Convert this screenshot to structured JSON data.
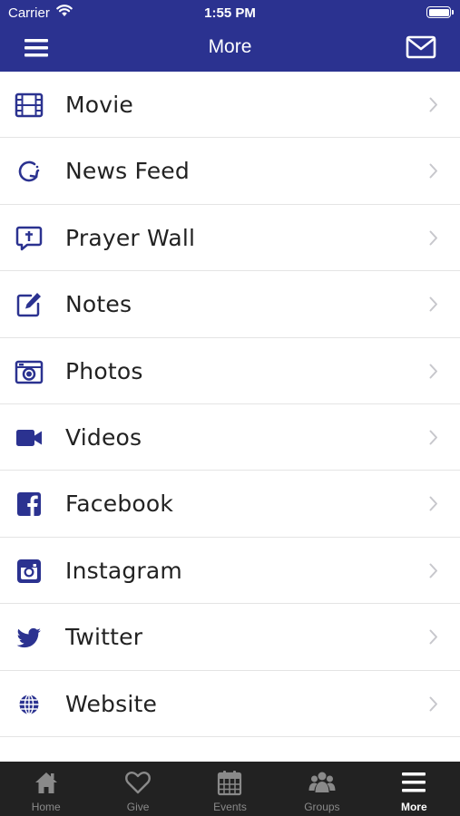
{
  "status_bar": {
    "carrier": "Carrier",
    "time": "1:55 PM"
  },
  "header": {
    "title": "More",
    "menu_icon": "hamburger-menu-icon",
    "mail_icon": "envelope-icon"
  },
  "colors": {
    "brand": "#2b3290",
    "tabbar_bg": "#222222",
    "tab_inactive": "#8a8a8a",
    "tab_active": "#ffffff",
    "chevron": "#c7c7cc"
  },
  "menu": {
    "items": [
      {
        "label": "Movie",
        "icon": "film-icon"
      },
      {
        "label": "News Feed",
        "icon": "refresh-icon"
      },
      {
        "label": "Prayer Wall",
        "icon": "prayer-icon"
      },
      {
        "label": "Notes",
        "icon": "edit-icon"
      },
      {
        "label": "Photos",
        "icon": "camera-icon"
      },
      {
        "label": "Videos",
        "icon": "video-camera-icon"
      },
      {
        "label": "Facebook",
        "icon": "facebook-icon"
      },
      {
        "label": "Instagram",
        "icon": "instagram-icon"
      },
      {
        "label": "Twitter",
        "icon": "twitter-icon"
      },
      {
        "label": "Website",
        "icon": "globe-icon"
      }
    ]
  },
  "tabs": [
    {
      "label": "Home",
      "icon": "home-icon",
      "active": false
    },
    {
      "label": "Give",
      "icon": "heart-icon",
      "active": false
    },
    {
      "label": "Events",
      "icon": "calendar-icon",
      "active": false
    },
    {
      "label": "Groups",
      "icon": "groups-icon",
      "active": false
    },
    {
      "label": "More",
      "icon": "hamburger-menu-icon",
      "active": true
    }
  ]
}
